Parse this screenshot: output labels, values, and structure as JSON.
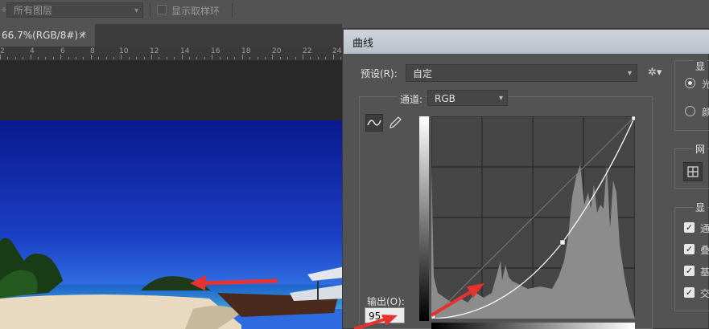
{
  "options_bar": {
    "left_glyph": "÷",
    "layer_select": "所有图层",
    "sample_ring_label": "显示取样环"
  },
  "document": {
    "tab_title": "66.7%(RGB/8#) *",
    "tab_close": "×",
    "ruler_labels": [
      "2",
      "4",
      "6",
      "8",
      "10",
      "12",
      "14",
      "16",
      "18",
      "20",
      "22",
      "24"
    ]
  },
  "dialog": {
    "title": "曲线",
    "preset_label": "预设(R):",
    "preset_value": "自定",
    "channel_label": "通道:",
    "channel_value": "RGB",
    "output_label": "输出(O):",
    "output_value": "95"
  },
  "right_panel": {
    "display_title": "显",
    "radio_1": "光",
    "radio_2": "颜",
    "grid_title": "网",
    "show_title": "显",
    "checks": [
      "通",
      "叠",
      "基",
      "交"
    ]
  },
  "colors": {
    "ui_background": "#535353",
    "dialog_titlebar": "#c4cad3",
    "annotation_arrow": "#e8322d"
  },
  "icons": {
    "curve_tool": "curve-wave-icon",
    "pencil_tool": "pencil-icon",
    "preset_menu": "gear-icon",
    "grid": "grid-icon"
  }
}
